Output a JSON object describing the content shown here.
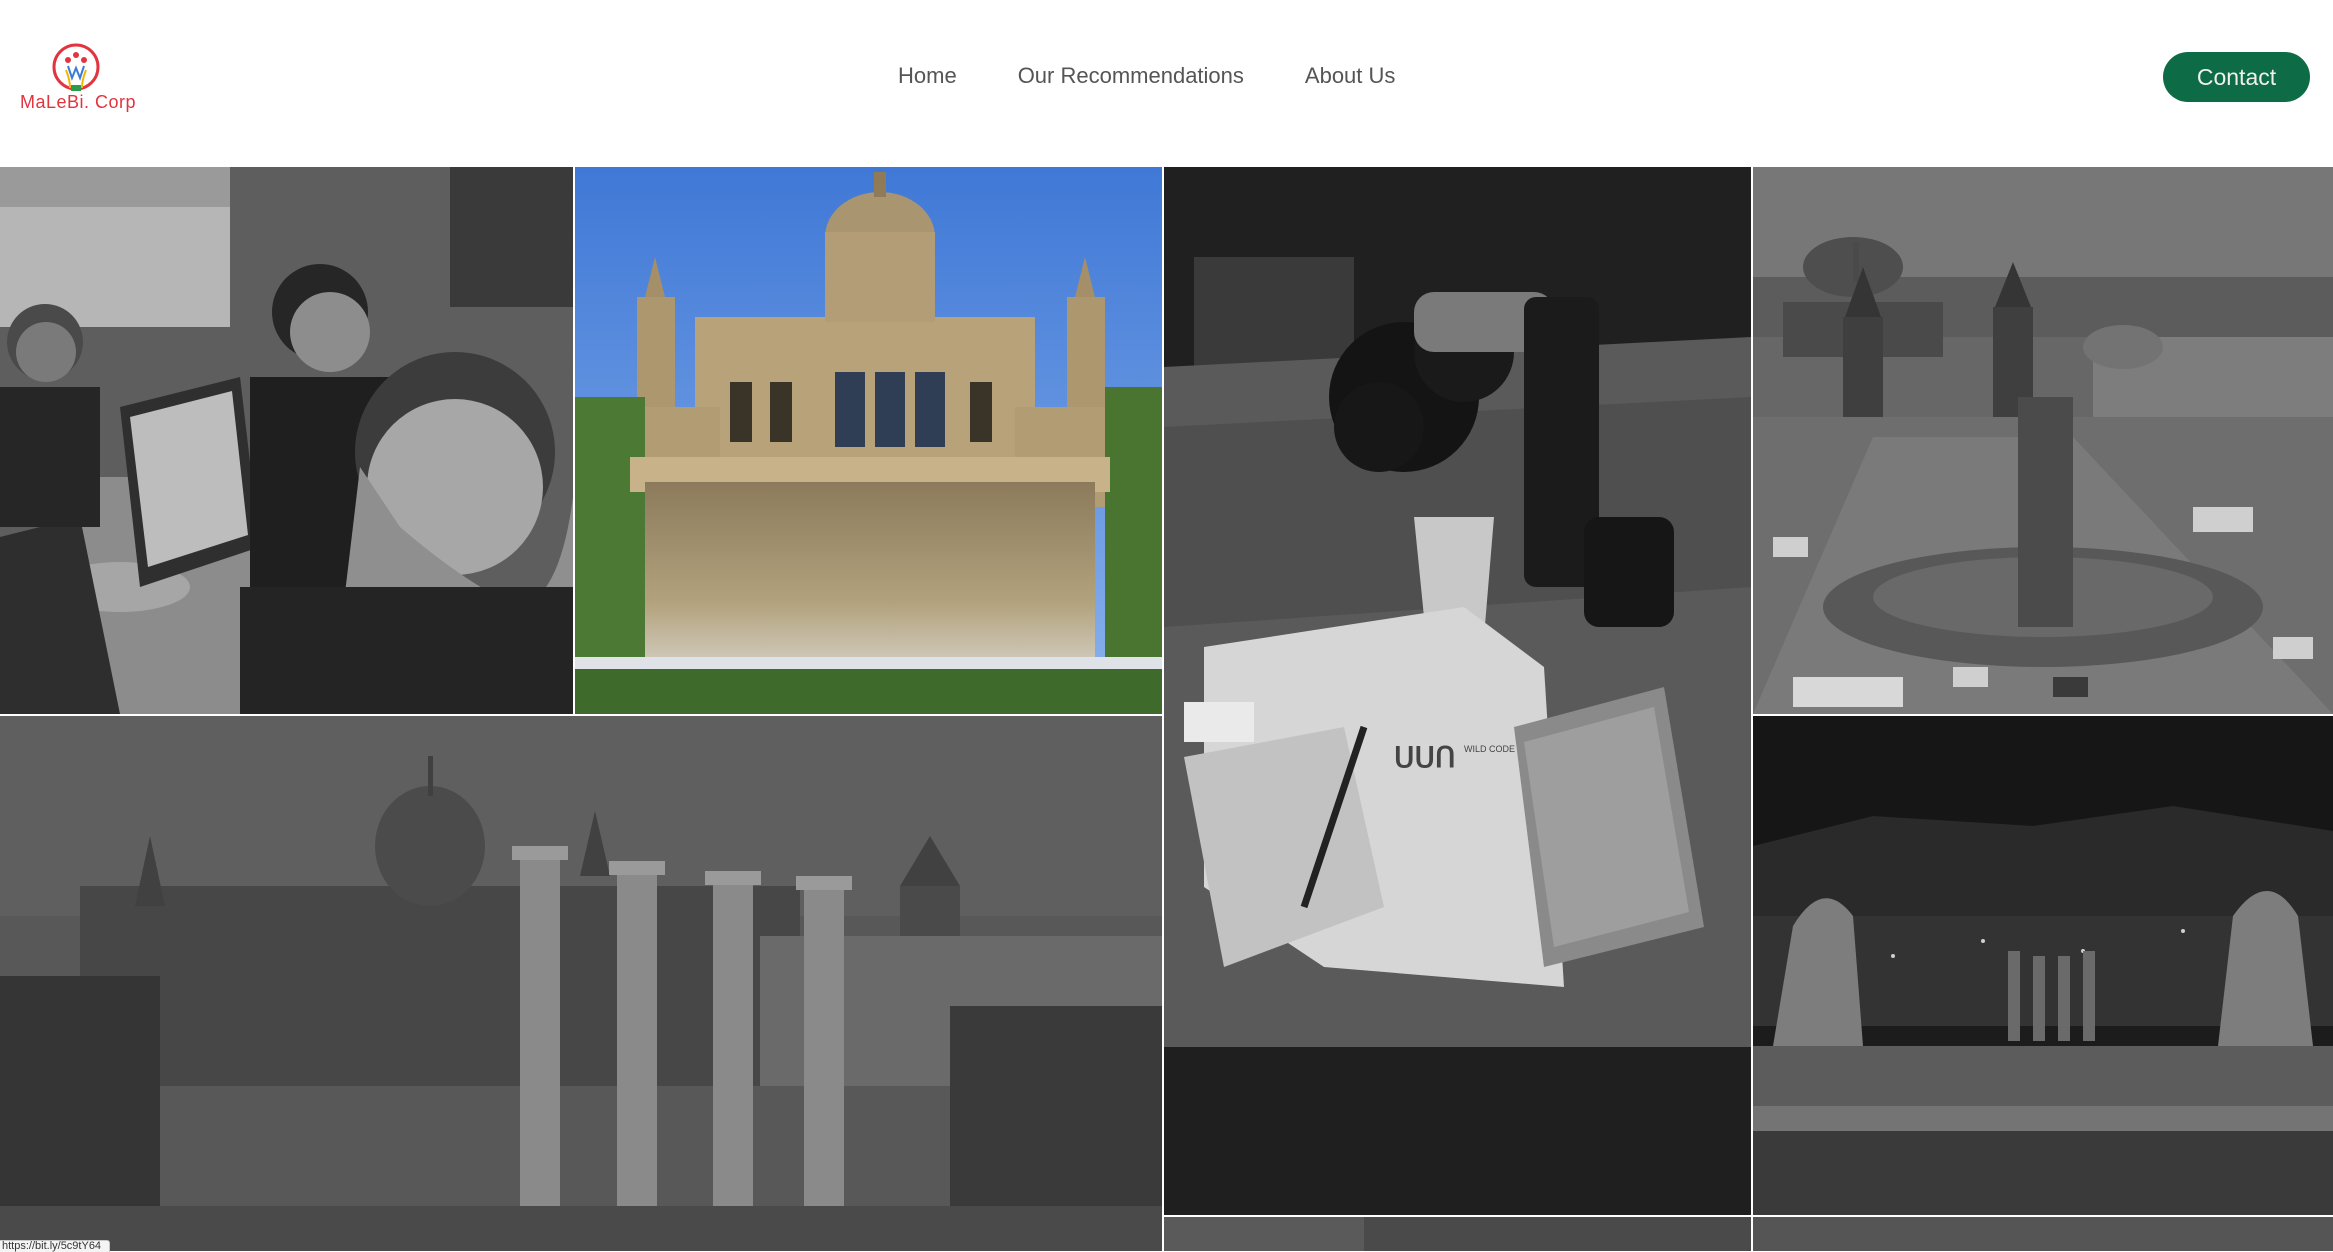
{
  "brand": {
    "logo_text": "MaLeBi. Corp",
    "logo_icon": "lightbulb-logo-icon",
    "colors": {
      "logo_red": "#e2343f",
      "accent_green": "#0d6b45"
    }
  },
  "nav": {
    "items": [
      {
        "label": "Home"
      },
      {
        "label": "Our Recommendations"
      },
      {
        "label": "About Us"
      }
    ],
    "contact_label": "Contact"
  },
  "gallery": {
    "photos": [
      {
        "subject": "group-selfie",
        "color": false
      },
      {
        "subject": "palace-waterfall",
        "color": true
      },
      {
        "subject": "desk-tshirt-notebook",
        "color": false
      },
      {
        "subject": "plaza-aerial",
        "color": false
      },
      {
        "subject": "palace-columns",
        "color": false
      },
      {
        "subject": "night-city-statues",
        "color": false
      }
    ],
    "tshirt_print": "WILD CODE SCHOOL"
  },
  "status_bar": {
    "url": "https://bit.ly/5c9tY64"
  }
}
